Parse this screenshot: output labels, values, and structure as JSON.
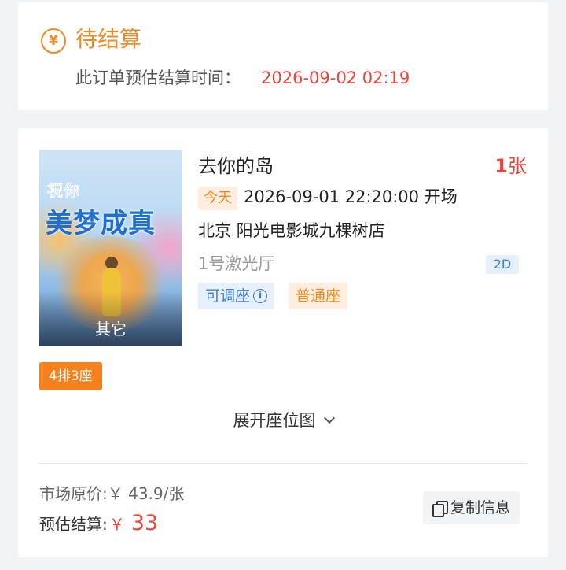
{
  "status": {
    "icon": "yen-circle-icon",
    "title": "待结算",
    "settle_label": "此订单预估结算时间：",
    "settle_time": "2026-09-02 02:19"
  },
  "movie": {
    "poster_art_small": "祝你",
    "poster_art_big": "美梦成真",
    "poster_tag": "其它",
    "title": "去你的岛",
    "ticket_count": "1",
    "ticket_unit": "张",
    "today_badge": "今天",
    "showtime": "2026-09-01 22:20:00 开场",
    "cinema": "北京 阳光电影城九棵树店",
    "hall": "1号激光厅",
    "format": "2D",
    "seat_adjust": "可调座",
    "seat_type": "普通座",
    "seat": "4排3座",
    "expand_map": "展开座位图"
  },
  "pricing": {
    "market_price": "市场原价:￥ 43.9/张",
    "estimate_label": "预估结算:",
    "estimate_currency": "￥",
    "estimate_amount": "33",
    "copy_label": "复制信息"
  },
  "colors": {
    "accent_orange": "#f08a24",
    "price_red": "#e8453c",
    "info_blue": "#3a7fd6",
    "background": "#f2f3f5"
  }
}
